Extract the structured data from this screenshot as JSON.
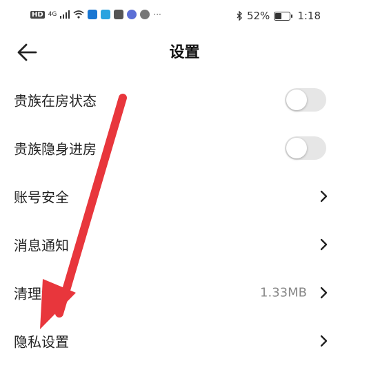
{
  "status_bar": {
    "network": "HD",
    "signal_type": "4G",
    "battery_level": 0.52,
    "battery_text": "52%",
    "time": "1:18",
    "more": "···"
  },
  "header": {
    "title": "设置"
  },
  "settings": [
    {
      "label": "贵族在房状态",
      "type": "toggle",
      "on": false
    },
    {
      "label": "贵族隐身进房",
      "type": "toggle",
      "on": false
    },
    {
      "label": "账号安全",
      "type": "link"
    },
    {
      "label": "消息通知",
      "type": "link"
    },
    {
      "label": "清理缓存",
      "type": "link",
      "value": "1.33MB"
    },
    {
      "label": "隐私设置",
      "type": "link"
    }
  ],
  "colors": {
    "annotation_arrow": "#e8363c",
    "toggle_off": "#e6e6e6",
    "value_text": "#888888"
  }
}
